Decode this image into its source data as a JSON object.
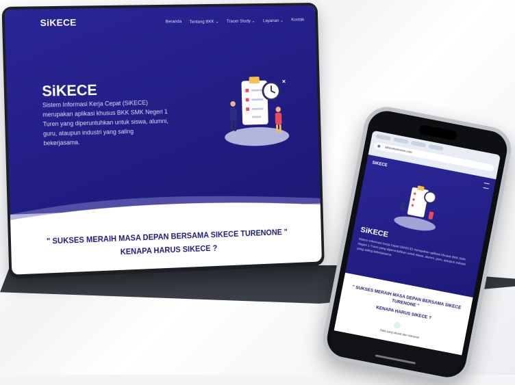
{
  "site": {
    "logo": "SiKECE",
    "nav": [
      "Beranda",
      "Tentang BKK ⌄",
      "Tracer Study ⌄",
      "Layanan ⌄",
      "Kontak"
    ],
    "hero_title": "SiKECE",
    "hero_text": "Sistem Informasi Kerja Cepat (SiKECE) merupakan aplikasi khusus BKK SMK Negeri 1 Turen yang diperuntuhkan untuk siswa, alumni, guru, ataupun industri yang saling bekerjasama.",
    "tagline": "\" SUKSES MERAIH MASA DEPAN BERSAMA SIKECE TURENONE \"",
    "subtitle": "KENAPA HARUS SIKECE ?"
  },
  "phone": {
    "url": "sikeceturenone.com",
    "logo": "SiKECE",
    "hero_title": "SiKECE",
    "hero_text": "Sistem Informasi Kerja Cepat (SiKECE) merupakan aplikasi khusus BKK SMK Negeri 1 Turen yang diperuntuhkan untuk siswa, alumni, guru, ataupun industri yang saling bekerjasama.",
    "tagline": "\" SUKSES MERAIH MASA DEPAN BERSAMA SIKECE TURENONE \"",
    "subtitle": "KENAPA HARUS SIKECE ?",
    "feature": "Data yang akurat dan relevansi"
  },
  "colors": {
    "brand": "#221d83",
    "accent_text": "#1e1a7a"
  },
  "icons": [
    "clipboard-checklist-illustration",
    "clock-icon",
    "menu-icon"
  ]
}
